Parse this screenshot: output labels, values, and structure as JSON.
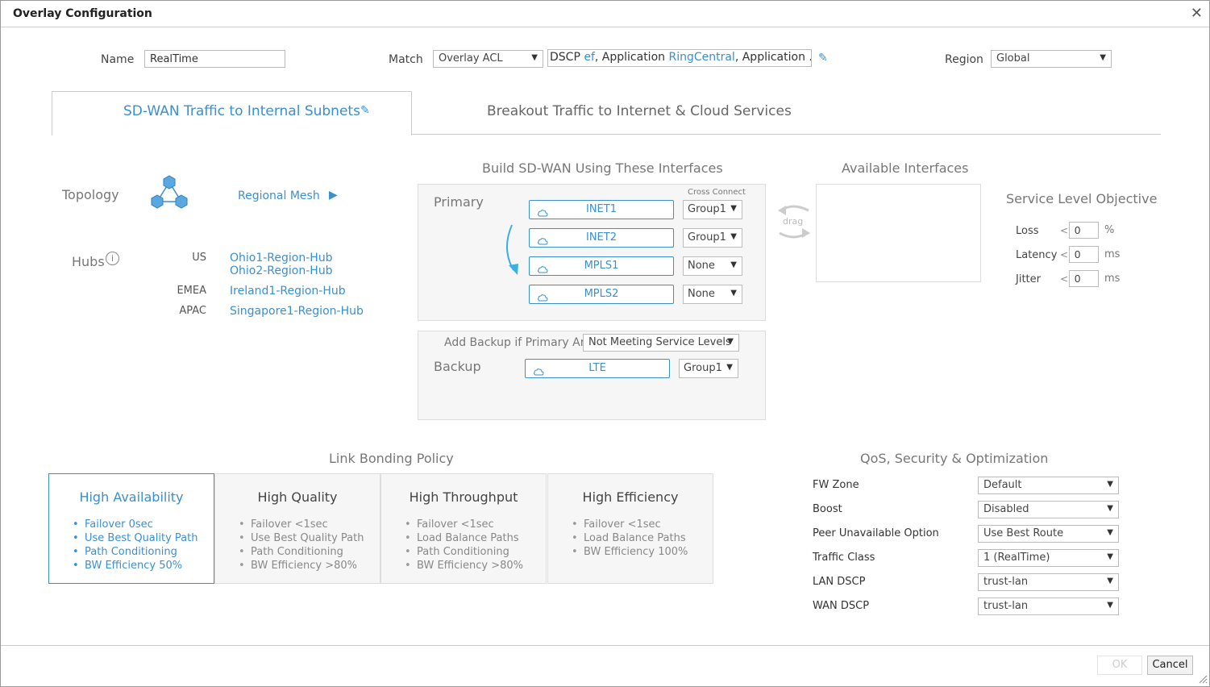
{
  "dialog": {
    "title": "Overlay Configuration"
  },
  "name": {
    "label": "Name",
    "value": "RealTime"
  },
  "match": {
    "label": "Match",
    "type": "Overlay ACL",
    "expr": [
      {
        "t": "DSCP ",
        "hl": false
      },
      {
        "t": "ef",
        "hl": true
      },
      {
        "t": ", Application ",
        "hl": false
      },
      {
        "t": "RingCentral",
        "hl": true
      },
      {
        "t": ", Application ...",
        "hl": false
      }
    ]
  },
  "region": {
    "label": "Region",
    "value": "Global"
  },
  "tabs": [
    {
      "label": "SD-WAN Traffic to Internal Subnets"
    },
    {
      "label": "Breakout Traffic to Internet & Cloud Services"
    }
  ],
  "topology": {
    "label": "Topology",
    "value": "Regional Mesh"
  },
  "hubs": {
    "label": "Hubs",
    "groups": [
      {
        "region": "US",
        "hubs": [
          "Ohio1-Region-Hub",
          "Ohio2-Region-Hub"
        ]
      },
      {
        "region": "EMEA",
        "hubs": [
          "Ireland1-Region-Hub"
        ]
      },
      {
        "region": "APAC",
        "hubs": [
          "Singapore1-Region-Hub"
        ]
      }
    ]
  },
  "build": {
    "title": "Build SD-WAN Using These Interfaces",
    "primary_label": "Primary",
    "cross_connect_label": "Cross Connect",
    "primary": [
      {
        "name": "INET1",
        "group": "Group1"
      },
      {
        "name": "INET2",
        "group": "Group1"
      },
      {
        "name": "MPLS1",
        "group": "None"
      },
      {
        "name": "MPLS2",
        "group": "None"
      }
    ],
    "add_backup_label": "Add Backup if Primary Are",
    "add_backup_value": "Not Meeting Service Levels",
    "backup_label": "Backup",
    "backup": [
      {
        "name": "LTE",
        "group": "Group1"
      }
    ]
  },
  "drag_label": "drag",
  "available": {
    "title": "Available Interfaces"
  },
  "slo": {
    "title": "Service Level Objective",
    "rows": [
      {
        "label": "Loss",
        "op": "<",
        "value": "0",
        "unit": "%"
      },
      {
        "label": "Latency",
        "op": "<",
        "value": "0",
        "unit": "ms"
      },
      {
        "label": "Jitter",
        "op": "<",
        "value": "0",
        "unit": "ms"
      }
    ]
  },
  "bonding": {
    "title": "Link Bonding Policy",
    "selected": 0,
    "cards": [
      {
        "title": "High Availability",
        "items": [
          "Failover 0sec",
          "Use Best Quality Path",
          "Path Conditioning",
          "BW Efficiency 50%"
        ]
      },
      {
        "title": "High Quality",
        "items": [
          "Failover <1sec",
          "Use Best Quality Path",
          "Path Conditioning",
          "BW Efficiency >80%"
        ]
      },
      {
        "title": "High Throughput",
        "items": [
          "Failover <1sec",
          "Load Balance Paths",
          "Path Conditioning",
          "BW Efficiency >80%"
        ]
      },
      {
        "title": "High Efficiency",
        "items": [
          "Failover <1sec",
          "Load Balance Paths",
          "BW Efficiency 100%"
        ]
      }
    ]
  },
  "qos": {
    "title": "QoS, Security & Optimization",
    "rows": [
      {
        "label": "FW Zone",
        "value": "Default"
      },
      {
        "label": "Boost",
        "value": "Disabled"
      },
      {
        "label": "Peer Unavailable Option",
        "value": "Use Best Route"
      },
      {
        "label": "Traffic Class",
        "value": "1 (RealTime)"
      },
      {
        "label": "LAN DSCP",
        "value": "trust-lan"
      },
      {
        "label": "WAN DSCP",
        "value": "trust-lan"
      }
    ]
  },
  "footer": {
    "ok_label": "OK",
    "cancel_label": "Cancel"
  },
  "colors": {
    "accent": "#3a8fd0",
    "panel": "#f6f6f6",
    "border": "#dddddd"
  }
}
